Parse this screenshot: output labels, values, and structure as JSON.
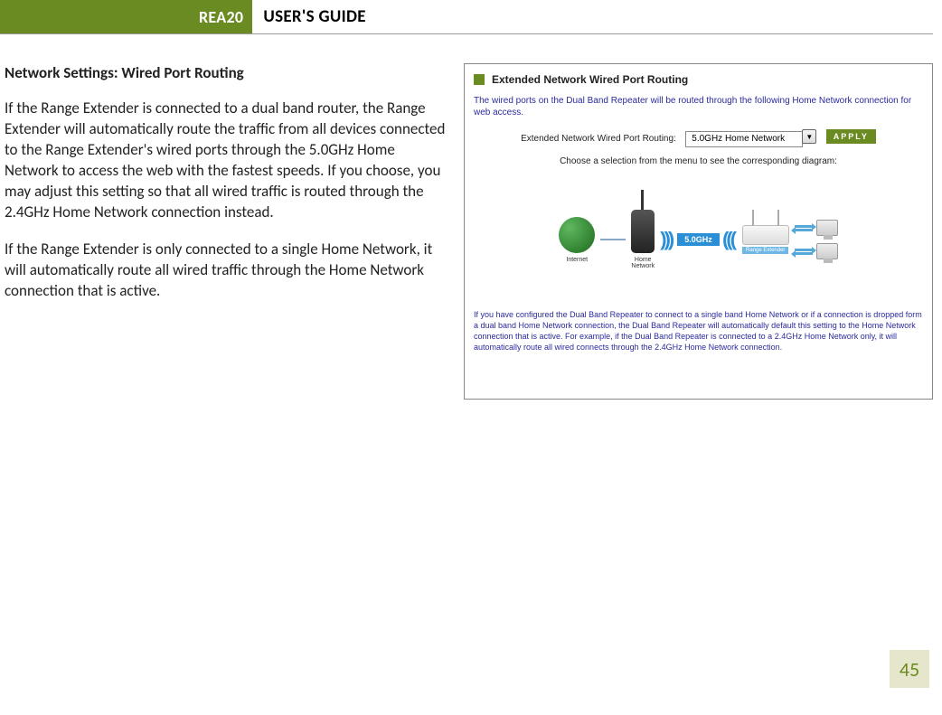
{
  "header": {
    "badge": "REA20",
    "title": "USER'S GUIDE"
  },
  "section_title": "Network Settings: Wired Port Routing",
  "paragraphs": [
    "If the Range Extender is connected to a dual band router, the Range Extender will automatically route the traffic from all devices connected to the Range Extender's wired ports through the 5.0GHz Home Network to access the web with the fastest speeds. If you choose, you may adjust this setting so that all wired traffic is routed through the 2.4GHz Home Network connection instead.",
    "If the Range Extender is only connected to a single Home Network, it will automatically route all wired traffic through the Home Network connection that is active."
  ],
  "screenshot": {
    "title": "Extended Network Wired Port Routing",
    "description": "The wired ports on the Dual Band Repeater will be routed through the following Home Network connection for web access.",
    "field_label": "Extended Network Wired Port Routing:",
    "select_value": "5.0GHz Home Network",
    "apply_label": "APPLY",
    "instruction": "Choose a selection from the menu to see the corresponding diagram:",
    "diagram": {
      "internet_label": "Internet",
      "home_network_label": "Home\nNetwork",
      "band_label": "5.0GHz",
      "extender_label": "Range Extender"
    },
    "footnote": "If you have configured the Dual Band Repeater to connect to a single band Home Network or if a connection is dropped form a dual band Home Network connection, the Dual Band Repeater will automatically default this setting to the Home Network connection that is active. For example, if the Dual Band Repeater is connected to a 2.4GHz Home Network only, it will automatically route all wired connects through the 2.4GHz Home Network connection."
  },
  "page_number": "45"
}
